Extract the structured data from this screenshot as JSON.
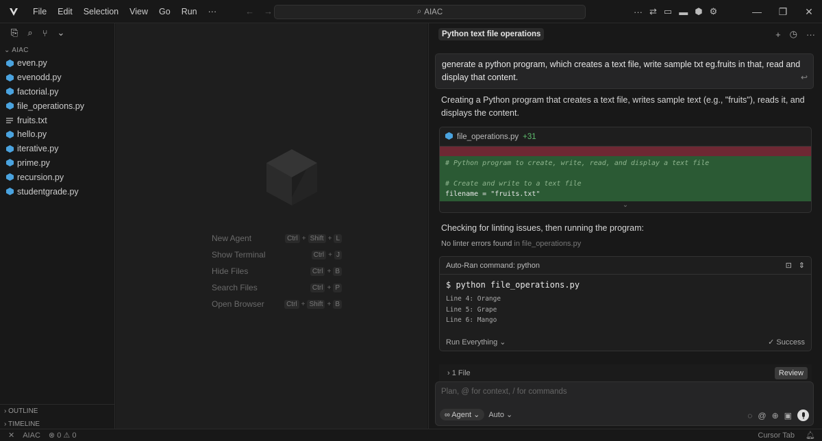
{
  "menu": [
    "File",
    "Edit",
    "Selection",
    "View",
    "Go",
    "Run",
    "···"
  ],
  "search": {
    "text": "AIAC"
  },
  "sidebar": {
    "folder": "AIAC",
    "files": [
      {
        "name": "even.py",
        "type": "py"
      },
      {
        "name": "evenodd.py",
        "type": "py"
      },
      {
        "name": "factorial.py",
        "type": "py"
      },
      {
        "name": "file_operations.py",
        "type": "py"
      },
      {
        "name": "fruits.txt",
        "type": "txt"
      },
      {
        "name": "hello.py",
        "type": "py"
      },
      {
        "name": "iterative.py",
        "type": "py"
      },
      {
        "name": "prime.py",
        "type": "py"
      },
      {
        "name": "recursion.py",
        "type": "py"
      },
      {
        "name": "studentgrade.py",
        "type": "py"
      }
    ],
    "outline": "OUTLINE",
    "timeline": "TIMELINE"
  },
  "editor": {
    "shortcuts": [
      {
        "label": "New Agent",
        "keys": [
          "Ctrl",
          "Shift",
          "L"
        ]
      },
      {
        "label": "Show Terminal",
        "keys": [
          "Ctrl",
          "J"
        ]
      },
      {
        "label": "Hide Files",
        "keys": [
          "Ctrl",
          "B"
        ]
      },
      {
        "label": "Search Files",
        "keys": [
          "Ctrl",
          "P"
        ]
      },
      {
        "label": "Open Browser",
        "keys": [
          "Ctrl",
          "Shift",
          "B"
        ]
      }
    ]
  },
  "chat": {
    "tab_title": "Python text file operations",
    "user_message": "generate a python program, which creates a text file, write sample txt eg.fruits in that, read and display that content.",
    "reply": "Creating a Python program that creates a text file, writes sample text (e.g., \"fruits\"), reads it, and displays the content.",
    "code_card": {
      "filename": "file_operations.py",
      "added": "+31",
      "lines": [
        {
          "kind": "comment",
          "text": "# Python program to create, write, read, and display a text file"
        },
        {
          "kind": "blank",
          "text": ""
        },
        {
          "kind": "comment",
          "text": "# Create and write to a text file"
        },
        {
          "kind": "code",
          "text": "filename = \"fruits.txt\""
        }
      ]
    },
    "lint_heading": "Checking for linting issues, then running the program:",
    "lint_status": "No linter errors found",
    "lint_file": "in file_operations.py",
    "terminal": {
      "title": "Auto-Ran command: python",
      "command": "$ python file_operations.py",
      "output": [
        "Line 4: Orange",
        "Line 5: Grape",
        "Line 6: Mango"
      ],
      "run_mode": "Run Everything",
      "result": "Success"
    },
    "files_bar": {
      "label": "1 File",
      "review": "Review"
    },
    "composer": {
      "placeholder": "Plan, @ for context, / for commands",
      "mode": "Agent",
      "model": "Auto"
    }
  },
  "status": {
    "folder": "AIAC",
    "problems": "0",
    "warnings": "0",
    "right": "Cursor Tab"
  },
  "colors": {
    "accent": "#4aa3df",
    "added_green": "#2b5a34",
    "deleted_red": "#6e2833"
  }
}
